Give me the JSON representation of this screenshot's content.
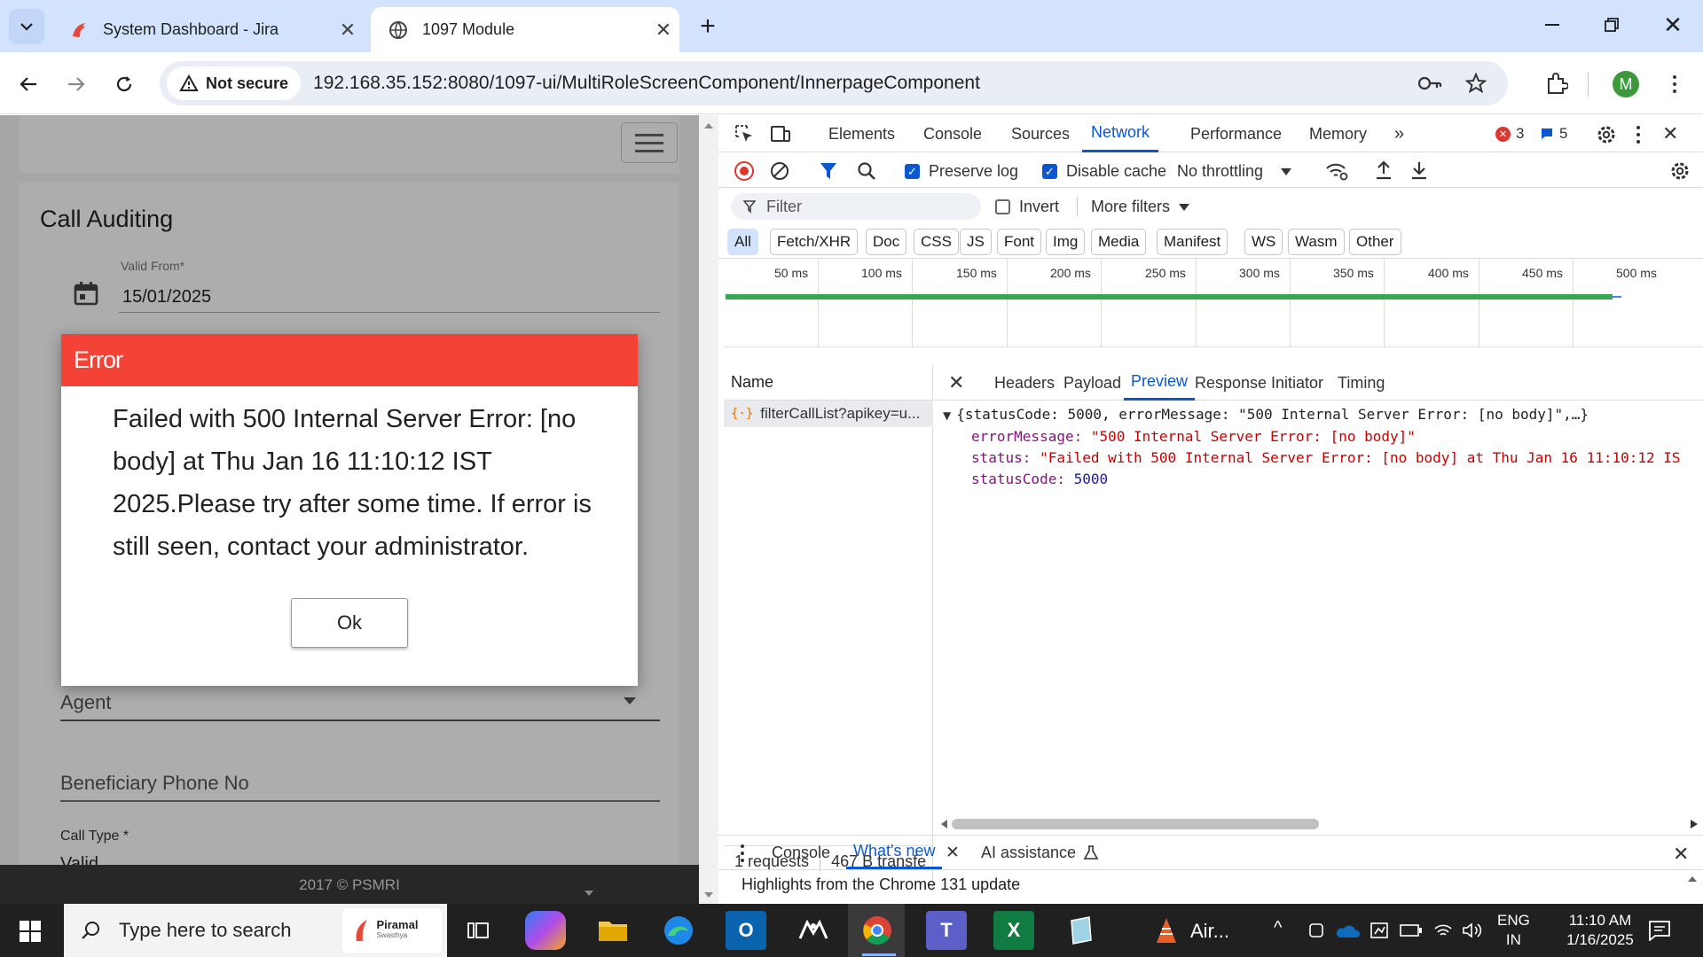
{
  "browser": {
    "tabs": [
      {
        "title": "System Dashboard - Jira"
      },
      {
        "title": "1097 Module"
      }
    ],
    "security_label": "Not secure",
    "url": "192.168.35.152:8080/1097-ui/MultiRoleScreenComponent/InnerpageComponent",
    "profile_initial": "M"
  },
  "page": {
    "card_title": "Call Auditing",
    "valid_from_label": "Valid From*",
    "valid_from_value": "15/01/2025",
    "agent_label": "Agent",
    "beneficiary_label": "Beneficiary Phone No",
    "call_type_label": "Call Type *",
    "call_type_value": "Valid",
    "footer": "2017 © PSMRI"
  },
  "modal": {
    "title": "Error",
    "message": "Failed with 500 Internal Server Error: [no body] at Thu Jan 16 11:10:12 IST 2025.Please try after some time. If error is still seen, contact your administrator.",
    "ok_label": "Ok"
  },
  "devtools": {
    "tabs": [
      "Elements",
      "Console",
      "Sources",
      "Network",
      "Performance",
      "Memory"
    ],
    "active_tab": "Network",
    "error_count": "3",
    "message_count": "5",
    "preserve_log_label": "Preserve log",
    "disable_cache_label": "Disable cache",
    "throttling": "No throttling",
    "filter_placeholder": "Filter",
    "invert_label": "Invert",
    "more_filters_label": "More filters",
    "type_filters": [
      "All",
      "Fetch/XHR",
      "Doc",
      "CSS",
      "JS",
      "Font",
      "Img",
      "Media",
      "Manifest",
      "WS",
      "Wasm",
      "Other"
    ],
    "timeline_ticks": [
      "50 ms",
      "100 ms",
      "150 ms",
      "200 ms",
      "250 ms",
      "300 ms",
      "350 ms",
      "400 ms",
      "450 ms",
      "500 ms"
    ],
    "name_header": "Name",
    "request_name": "filterCallList?apikey=u...",
    "requests_count": "1 requests",
    "transferred": "467 B transfe",
    "detail_tabs": [
      "Headers",
      "Payload",
      "Preview",
      "Response",
      "Initiator",
      "Timing"
    ],
    "active_detail_tab": "Preview",
    "preview": {
      "summary": "{statusCode: 5000, errorMessage: \"500 Internal Server Error: [no body]\",…}",
      "error_message_key": "errorMessage",
      "error_message_value": "\"500 Internal Server Error: [no body]\"",
      "status_key": "status",
      "status_value": "\"Failed with 500 Internal Server Error: [no body] at Thu Jan 16 11:10:12 IS",
      "status_code_key": "statusCode",
      "status_code_value": "5000"
    },
    "drawer_tabs": [
      "Console",
      "What's new",
      "AI assistance"
    ],
    "active_drawer_tab": "What's new",
    "drawer_content": "Highlights from the Chrome 131 update"
  },
  "taskbar": {
    "search_placeholder": "Type here to search",
    "search_badge": "Piramal",
    "search_badge_sub": "Swasthya",
    "pinned_label": "Air...",
    "language": "ENG",
    "region": "IN",
    "time": "11:10 AM",
    "date": "1/16/2025"
  },
  "colors": {
    "error_red": "#f44336",
    "chrome_blue": "#0b57d0",
    "tabstrip": "#d3e3fd"
  }
}
